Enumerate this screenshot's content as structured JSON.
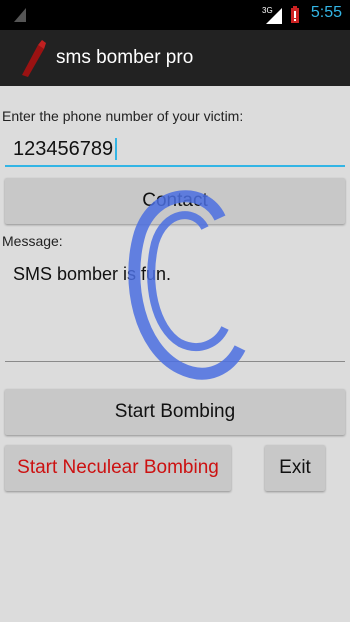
{
  "status_bar": {
    "network": "3G",
    "time": "5:55"
  },
  "action_bar": {
    "title": "sms bomber pro",
    "icon": "red-app-icon"
  },
  "form": {
    "phone_label": "Enter the phone number of your victim:",
    "phone_value": "123456789",
    "contact_button": "Contact",
    "message_label": "Message:",
    "message_value": "SMS bomber is fun.",
    "start_button": "Start Bombing",
    "nuke_button": "Start Neculear Bombing",
    "exit_button": "Exit"
  },
  "colors": {
    "accent": "#33b5e5",
    "danger_text": "#cc1111",
    "watermark": "#4b6fe0"
  }
}
